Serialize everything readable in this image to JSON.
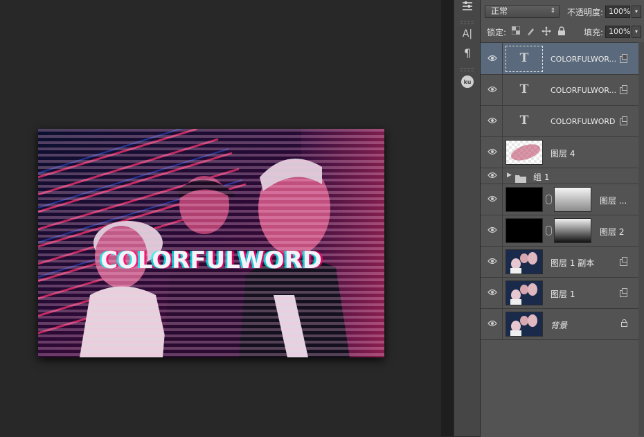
{
  "canvas": {
    "headline": "COLORFULWORD"
  },
  "tools": [
    {
      "name": "adjustments-icon",
      "glyph": "☷"
    },
    {
      "name": "character-icon",
      "glyph": "A|"
    },
    {
      "name": "paragraph-icon",
      "glyph": "¶"
    },
    {
      "name": "kuler-icon",
      "glyph": "ku"
    }
  ],
  "layers_panel": {
    "blend_mode": "正常",
    "opacity_label": "不透明度:",
    "opacity_value": "100%",
    "lock_label": "锁定:",
    "fill_label": "填充:",
    "fill_value": "100%",
    "layers": [
      {
        "name": "COLORFULWOR...",
        "kind": "text",
        "selected": true,
        "fx": true
      },
      {
        "name": "COLORFULWOR...",
        "kind": "text",
        "selected": false,
        "fx": true
      },
      {
        "name": "COLORFULWORD",
        "kind": "text",
        "selected": false,
        "fx": true
      },
      {
        "name": "图层 4",
        "kind": "pixel-pink",
        "selected": false,
        "fx": false
      },
      {
        "name": "组 1",
        "kind": "group",
        "selected": false,
        "fx": false
      },
      {
        "name": "图层 ...",
        "kind": "mask-light",
        "selected": false,
        "fx": false
      },
      {
        "name": "图层 2",
        "kind": "mask-dark",
        "selected": false,
        "fx": false
      },
      {
        "name": "图层 1 副本",
        "kind": "photo",
        "selected": false,
        "fx": true
      },
      {
        "name": "图层 1",
        "kind": "photo",
        "selected": false,
        "fx": true
      },
      {
        "name": "背景",
        "kind": "background",
        "selected": false,
        "fx": false
      }
    ]
  }
}
